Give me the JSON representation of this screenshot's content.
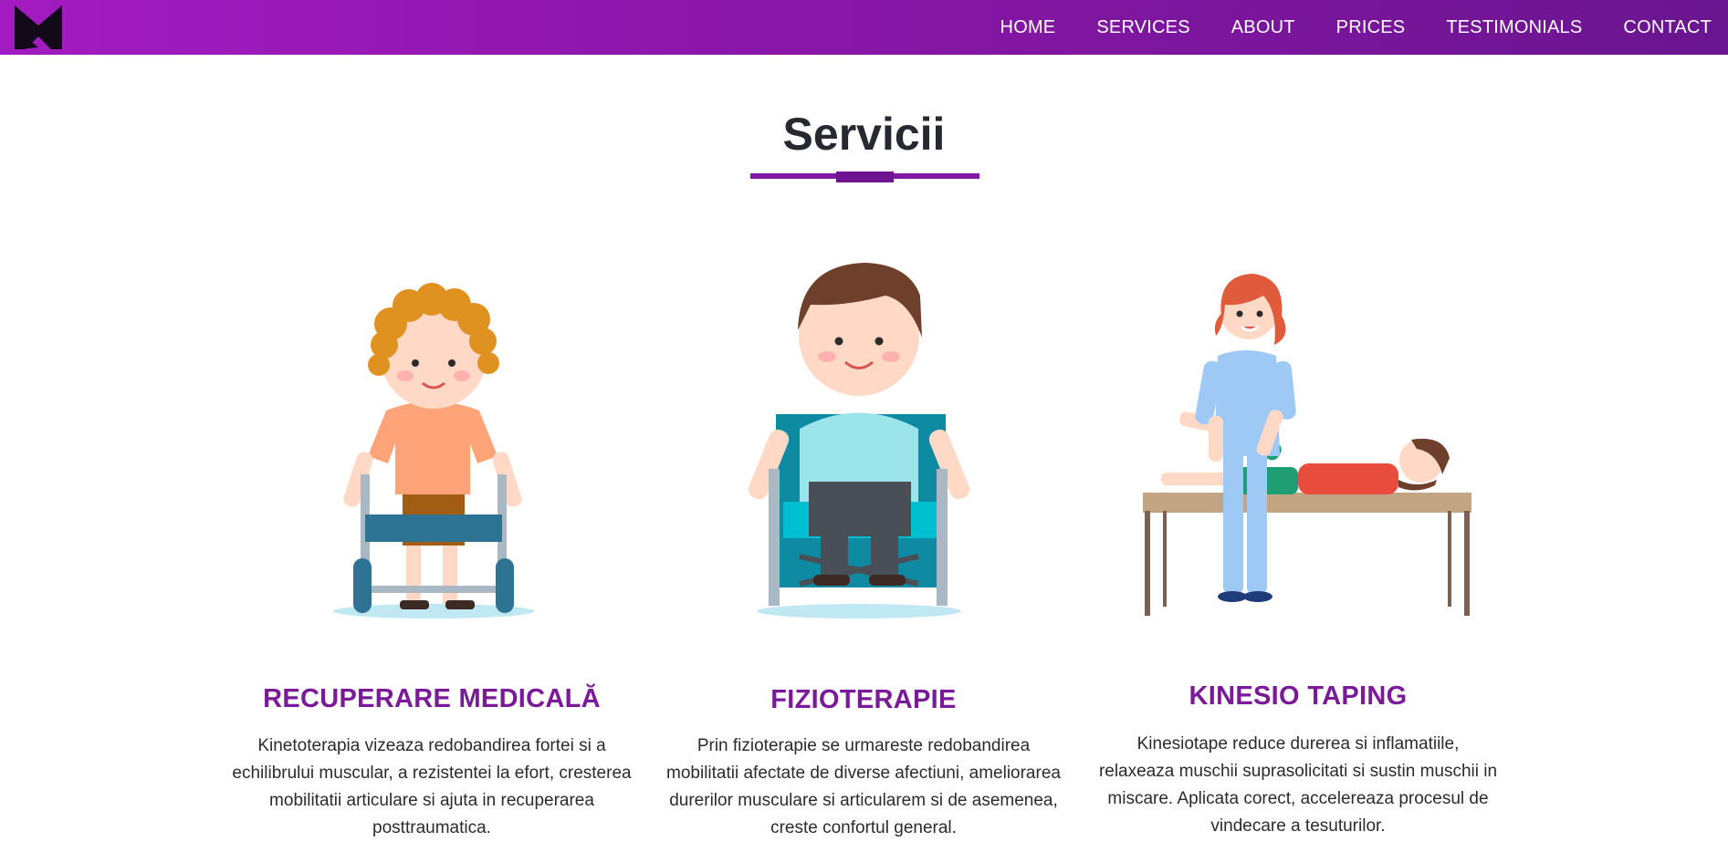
{
  "nav": {
    "logo_icon": "m-logo-icon",
    "links": [
      "HOME",
      "SERVICES",
      "ABOUT",
      "PRICES",
      "TESTIMONIALS",
      "CONTACT"
    ]
  },
  "section": {
    "title": "Servicii"
  },
  "services": [
    {
      "title": "RECUPERARE MEDICALĂ",
      "text": "Kinetoterapia vizeaza redobandirea fortei si a echilibrului muscular, a rezistentei la efort, cresterea mobilitatii articulare si ajuta in recuperarea posttraumatica."
    },
    {
      "title": "FIZIOTERAPIE",
      "text": "Prin fizioterapie se urmareste redobandirea mobilitatii afectate de diverse afectiuni, ameliorarea durerilor musculare si articularem si de asemenea, creste confortul general."
    },
    {
      "title": "KINESIO TAPING",
      "text": "Kinesiotape reduce durerea si inflamatiile, relaxeaza muschii suprasolicitati si sustin muschii in miscare. Aplicata corect, accelereaza procesul de vindecare a tesuturilor."
    }
  ],
  "colors": {
    "brand_purple": "#8019a4",
    "title_dark": "#262a30"
  }
}
